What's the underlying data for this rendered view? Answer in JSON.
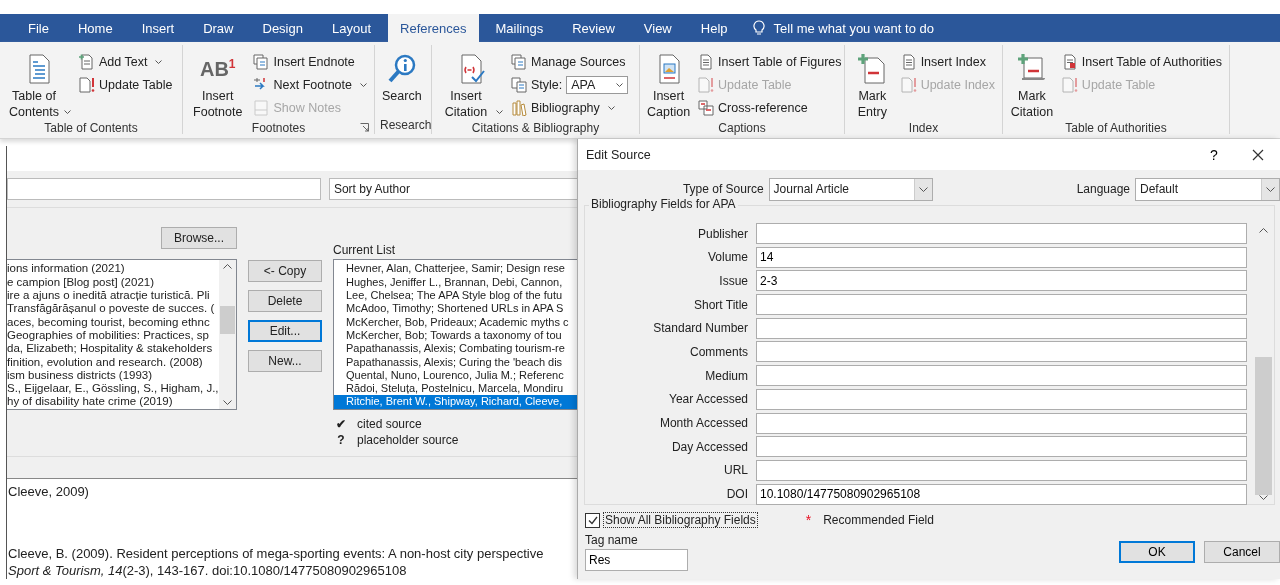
{
  "ribbon": {
    "tabs": [
      {
        "label": "File",
        "selected": false
      },
      {
        "label": "Home",
        "selected": false
      },
      {
        "label": "Insert",
        "selected": false
      },
      {
        "label": "Draw",
        "selected": false
      },
      {
        "label": "Design",
        "selected": false
      },
      {
        "label": "Layout",
        "selected": false
      },
      {
        "label": "References",
        "selected": true
      },
      {
        "label": "Mailings",
        "selected": false
      },
      {
        "label": "Review",
        "selected": false
      },
      {
        "label": "View",
        "selected": false
      },
      {
        "label": "Help",
        "selected": false
      }
    ],
    "tell_me": "Tell me what you want to do",
    "groups": [
      {
        "label": "Table of Contents",
        "launcher": false,
        "large": {
          "label": "Table of Contents",
          "dropdown": true
        },
        "items": [
          {
            "kind": "button",
            "label": "Add Text",
            "dropdown": true,
            "disabled": false
          },
          {
            "kind": "button",
            "label": "Update Table",
            "dropdown": false,
            "disabled": false
          }
        ]
      },
      {
        "label": "Footnotes",
        "launcher": true,
        "large": {
          "label": "Insert Footnote",
          "glyph": "AB$^{1}$",
          "dropdown": false
        },
        "items": [
          {
            "kind": "button",
            "label": "Insert Endnote",
            "dropdown": false,
            "disabled": false
          },
          {
            "kind": "button",
            "label": "Next Footnote",
            "dropdown": true,
            "disabled": false
          },
          {
            "kind": "button",
            "label": "Show Notes",
            "dropdown": false,
            "disabled": true
          }
        ]
      },
      {
        "label": "Research",
        "launcher": false,
        "large": {
          "label": "Search",
          "dropdown": false
        }
      },
      {
        "label": "Citations & Bibliography",
        "launcher": false,
        "large": {
          "label": "Insert Citation",
          "dropdown": true
        },
        "items": [
          {
            "kind": "button",
            "label": "Manage Sources",
            "dropdown": false,
            "disabled": false
          },
          {
            "kind": "combo",
            "label": "Style:",
            "value": "APA",
            "dropdown": true,
            "disabled": false
          },
          {
            "kind": "button",
            "label": "Bibliography",
            "dropdown": true,
            "disabled": false
          }
        ]
      },
      {
        "label": "Captions",
        "launcher": false,
        "large": {
          "label": "Insert Caption",
          "dropdown": false
        },
        "items": [
          {
            "kind": "button",
            "label": "Insert Table of Figures",
            "dropdown": false,
            "disabled": false
          },
          {
            "kind": "button",
            "label": "Update Table",
            "dropdown": false,
            "disabled": true
          },
          {
            "kind": "button",
            "label": "Cross-reference",
            "dropdown": false,
            "disabled": false
          }
        ]
      },
      {
        "label": "Index",
        "launcher": false,
        "large": {
          "label": "Mark Entry",
          "dropdown": false
        },
        "items": [
          {
            "kind": "button",
            "label": "Insert Index",
            "dropdown": false,
            "disabled": false
          },
          {
            "kind": "button",
            "label": "Update Index",
            "dropdown": false,
            "disabled": true
          }
        ]
      },
      {
        "label": "Table of Authorities",
        "launcher": false,
        "large": {
          "label": "Mark Citation",
          "dropdown": false
        },
        "items": [
          {
            "kind": "button",
            "label": "Insert Table of Authorities",
            "dropdown": false,
            "disabled": false
          },
          {
            "kind": "button",
            "label": "Update Table",
            "dropdown": false,
            "disabled": true
          }
        ]
      }
    ]
  },
  "source_manager": {
    "sort": "Sort by Author",
    "browse_button": "Browse...",
    "master_list": [
      {
        "text": "ions information (2021)",
        "selected": false
      },
      {
        "text": "e campion [Blog post] (2021)",
        "selected": false
      },
      {
        "text": "ire a ajuns o inedită atracție turistică. Pli",
        "selected": false
      },
      {
        "text": "Transfăgărășanul o poveste de succes. (",
        "selected": false
      },
      {
        "text": "aces, becoming tourist, becoming ethnc",
        "selected": false
      },
      {
        "text": "Geographies of mobilities: Practices, sp",
        "selected": false
      },
      {
        "text": "da, Elizabeth; Hospitality & stakeholders",
        "selected": false
      },
      {
        "text": "finition, evolution and research. (2008)",
        "selected": false
      },
      {
        "text": "ism business districts (1993)",
        "selected": false
      },
      {
        "text": "S., Eijgelaar, E., Gössling, S., Higham, J.,",
        "selected": false
      },
      {
        "text": "hy of disability hate crime (2019)",
        "selected": false
      }
    ],
    "buttons": [
      {
        "label": "<- Copy",
        "focused": false
      },
      {
        "label": "Delete",
        "focused": false
      },
      {
        "label": "Edit...",
        "focused": true
      },
      {
        "label": "New...",
        "focused": false
      }
    ],
    "current_list_label": "Current List",
    "current_list": [
      {
        "text": "Hevner, Alan, Chatterjee, Samir; Design rese",
        "selected": false
      },
      {
        "text": "Hughes, Jeniffer L., Brannan, Debi, Cannon,",
        "selected": false
      },
      {
        "text": "Lee, Chelsea; The APA Style blog of the futu",
        "selected": false
      },
      {
        "text": "McAdoo, Timothy; Shortened URLs in APA S",
        "selected": false
      },
      {
        "text": "McKercher, Bob, Prideaux; Academic myths c",
        "selected": false
      },
      {
        "text": "McKercher, Bob; Towards a taxonomy of tou",
        "selected": false
      },
      {
        "text": "Papathanassis, Alexis; Combating tourism-re",
        "selected": false
      },
      {
        "text": "Papathanassis, Alexis; Curing the 'beach dis",
        "selected": false
      },
      {
        "text": "Quental, Nuno, Lourenco, Julia M.; Referenc",
        "selected": false
      },
      {
        "text": "Rădoi, Steluța, Postelnicu, Marcela, Mondiru",
        "selected": false
      },
      {
        "text": "Ritchie, Brent W., Shipway, Richard, Cleeve,",
        "selected": true
      }
    ],
    "legend": [
      {
        "symbol": "✔",
        "label": "cited source"
      },
      {
        "symbol": "?",
        "label": "placeholder source"
      }
    ],
    "preview": {
      "citation": "Cleeve, 2009)",
      "bibliography": [
        "Cleeve, B. (2009). Resident perceptions of mega-sporting events: A non-host city perspective",
        "*Sport & Tourism, 14*(2-3), 143-167. doi:10.1080/14775080902965108"
      ]
    }
  },
  "edit_source": {
    "title": "Edit Source",
    "help": "?",
    "type_label": "Type of Source",
    "type_value": "Journal Article",
    "language_label": "Language",
    "language_value": "Default",
    "group_label": "Bibliography Fields for APA",
    "fields": [
      {
        "label": "Publisher"
      },
      {
        "label": "Volume",
        "value": "14"
      },
      {
        "label": "Issue",
        "value": "2-3"
      },
      {
        "label": "Short Title"
      },
      {
        "label": "Standard Number"
      },
      {
        "label": "Comments"
      },
      {
        "label": "Medium"
      },
      {
        "label": "Year Accessed"
      },
      {
        "label": "Month Accessed"
      },
      {
        "label": "Day Accessed"
      },
      {
        "label": "URL"
      },
      {
        "label": "DOI",
        "value": "10.1080/14775080902965108"
      }
    ],
    "show_all": {
      "label": "Show All Bibliography Fields",
      "checked": true
    },
    "recommended": {
      "symbol": "*",
      "label": "Recommended Field"
    },
    "tag_label": "Tag name",
    "tag_value": "Res",
    "buttons": [
      {
        "label": "OK",
        "focused": true
      },
      {
        "label": "Cancel",
        "focused": false
      }
    ]
  }
}
